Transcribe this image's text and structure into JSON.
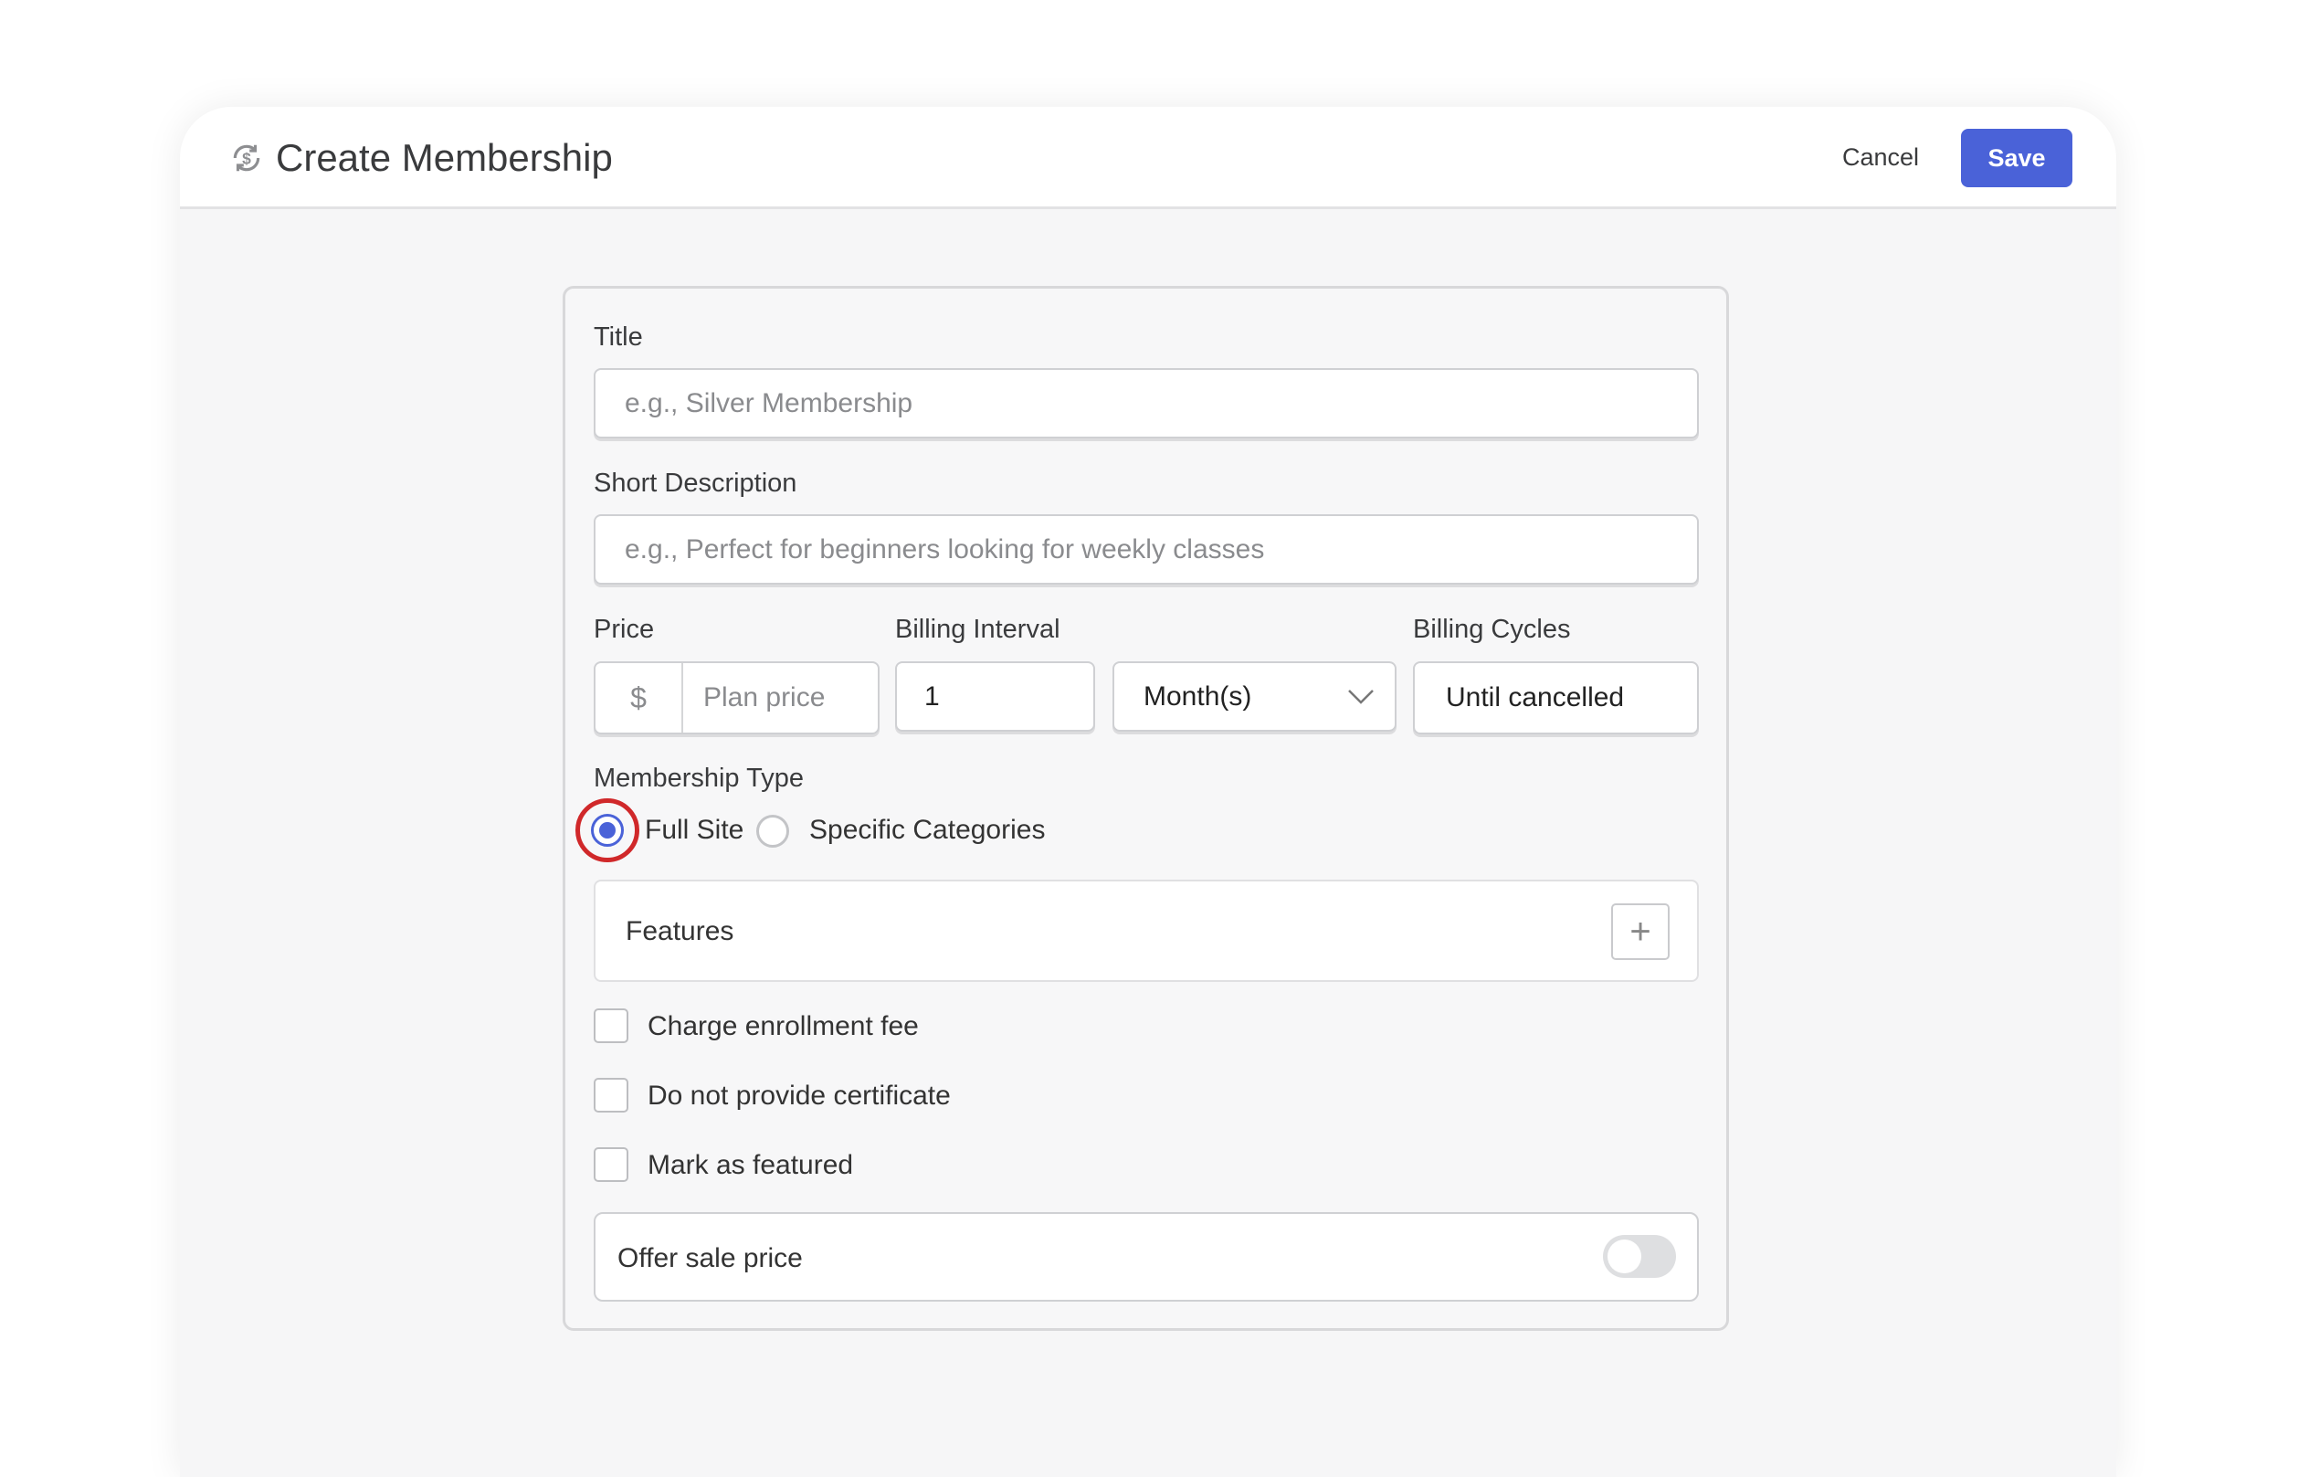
{
  "header": {
    "title": "Create Membership",
    "icon": "dollar-refresh-icon",
    "cancel_label": "Cancel",
    "save_label": "Save",
    "accent": "#4a62d8"
  },
  "form": {
    "title": {
      "label": "Title",
      "placeholder": "e.g., Silver Membership"
    },
    "short_description": {
      "label": "Short Description",
      "placeholder": "e.g., Perfect for beginners looking for weekly classes"
    },
    "price": {
      "label": "Price",
      "currency": "$",
      "placeholder": "Plan price"
    },
    "billing_interval": {
      "label": "Billing Interval",
      "value": "1",
      "unit": "Month(s)"
    },
    "billing_cycles": {
      "label": "Billing Cycles",
      "value": "Until cancelled"
    },
    "membership_type": {
      "label": "Membership Type",
      "options": [
        "Full Site",
        "Specific Categories"
      ],
      "selected": "Full Site"
    },
    "features": {
      "label": "Features"
    },
    "checkboxes": [
      {
        "label": "Charge enrollment fee",
        "checked": false
      },
      {
        "label": "Do not provide certificate",
        "checked": false
      },
      {
        "label": "Mark as featured",
        "checked": false
      }
    ],
    "sale": {
      "label": "Offer sale price",
      "enabled": false
    }
  }
}
